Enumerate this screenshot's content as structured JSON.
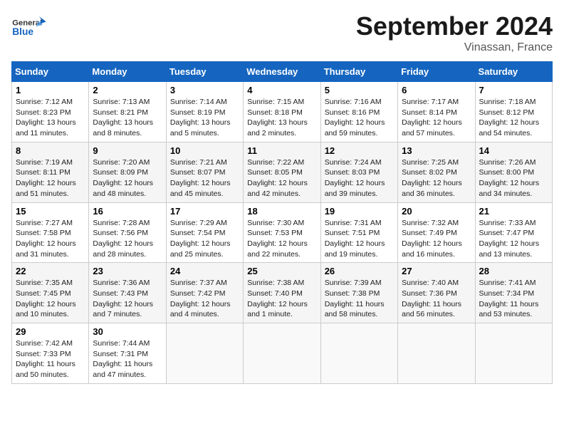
{
  "header": {
    "logo_line1": "General",
    "logo_line2": "Blue",
    "month": "September 2024",
    "location": "Vinassan, France"
  },
  "weekdays": [
    "Sunday",
    "Monday",
    "Tuesday",
    "Wednesday",
    "Thursday",
    "Friday",
    "Saturday"
  ],
  "weeks": [
    [
      {
        "day": "1",
        "info": "Sunrise: 7:12 AM\nSunset: 8:23 PM\nDaylight: 13 hours\nand 11 minutes."
      },
      {
        "day": "2",
        "info": "Sunrise: 7:13 AM\nSunset: 8:21 PM\nDaylight: 13 hours\nand 8 minutes."
      },
      {
        "day": "3",
        "info": "Sunrise: 7:14 AM\nSunset: 8:19 PM\nDaylight: 13 hours\nand 5 minutes."
      },
      {
        "day": "4",
        "info": "Sunrise: 7:15 AM\nSunset: 8:18 PM\nDaylight: 13 hours\nand 2 minutes."
      },
      {
        "day": "5",
        "info": "Sunrise: 7:16 AM\nSunset: 8:16 PM\nDaylight: 12 hours\nand 59 minutes."
      },
      {
        "day": "6",
        "info": "Sunrise: 7:17 AM\nSunset: 8:14 PM\nDaylight: 12 hours\nand 57 minutes."
      },
      {
        "day": "7",
        "info": "Sunrise: 7:18 AM\nSunset: 8:12 PM\nDaylight: 12 hours\nand 54 minutes."
      }
    ],
    [
      {
        "day": "8",
        "info": "Sunrise: 7:19 AM\nSunset: 8:11 PM\nDaylight: 12 hours\nand 51 minutes."
      },
      {
        "day": "9",
        "info": "Sunrise: 7:20 AM\nSunset: 8:09 PM\nDaylight: 12 hours\nand 48 minutes."
      },
      {
        "day": "10",
        "info": "Sunrise: 7:21 AM\nSunset: 8:07 PM\nDaylight: 12 hours\nand 45 minutes."
      },
      {
        "day": "11",
        "info": "Sunrise: 7:22 AM\nSunset: 8:05 PM\nDaylight: 12 hours\nand 42 minutes."
      },
      {
        "day": "12",
        "info": "Sunrise: 7:24 AM\nSunset: 8:03 PM\nDaylight: 12 hours\nand 39 minutes."
      },
      {
        "day": "13",
        "info": "Sunrise: 7:25 AM\nSunset: 8:02 PM\nDaylight: 12 hours\nand 36 minutes."
      },
      {
        "day": "14",
        "info": "Sunrise: 7:26 AM\nSunset: 8:00 PM\nDaylight: 12 hours\nand 34 minutes."
      }
    ],
    [
      {
        "day": "15",
        "info": "Sunrise: 7:27 AM\nSunset: 7:58 PM\nDaylight: 12 hours\nand 31 minutes."
      },
      {
        "day": "16",
        "info": "Sunrise: 7:28 AM\nSunset: 7:56 PM\nDaylight: 12 hours\nand 28 minutes."
      },
      {
        "day": "17",
        "info": "Sunrise: 7:29 AM\nSunset: 7:54 PM\nDaylight: 12 hours\nand 25 minutes."
      },
      {
        "day": "18",
        "info": "Sunrise: 7:30 AM\nSunset: 7:53 PM\nDaylight: 12 hours\nand 22 minutes."
      },
      {
        "day": "19",
        "info": "Sunrise: 7:31 AM\nSunset: 7:51 PM\nDaylight: 12 hours\nand 19 minutes."
      },
      {
        "day": "20",
        "info": "Sunrise: 7:32 AM\nSunset: 7:49 PM\nDaylight: 12 hours\nand 16 minutes."
      },
      {
        "day": "21",
        "info": "Sunrise: 7:33 AM\nSunset: 7:47 PM\nDaylight: 12 hours\nand 13 minutes."
      }
    ],
    [
      {
        "day": "22",
        "info": "Sunrise: 7:35 AM\nSunset: 7:45 PM\nDaylight: 12 hours\nand 10 minutes."
      },
      {
        "day": "23",
        "info": "Sunrise: 7:36 AM\nSunset: 7:43 PM\nDaylight: 12 hours\nand 7 minutes."
      },
      {
        "day": "24",
        "info": "Sunrise: 7:37 AM\nSunset: 7:42 PM\nDaylight: 12 hours\nand 4 minutes."
      },
      {
        "day": "25",
        "info": "Sunrise: 7:38 AM\nSunset: 7:40 PM\nDaylight: 12 hours\nand 1 minute."
      },
      {
        "day": "26",
        "info": "Sunrise: 7:39 AM\nSunset: 7:38 PM\nDaylight: 11 hours\nand 58 minutes."
      },
      {
        "day": "27",
        "info": "Sunrise: 7:40 AM\nSunset: 7:36 PM\nDaylight: 11 hours\nand 56 minutes."
      },
      {
        "day": "28",
        "info": "Sunrise: 7:41 AM\nSunset: 7:34 PM\nDaylight: 11 hours\nand 53 minutes."
      }
    ],
    [
      {
        "day": "29",
        "info": "Sunrise: 7:42 AM\nSunset: 7:33 PM\nDaylight: 11 hours\nand 50 minutes."
      },
      {
        "day": "30",
        "info": "Sunrise: 7:44 AM\nSunset: 7:31 PM\nDaylight: 11 hours\nand 47 minutes."
      },
      {
        "day": "",
        "info": ""
      },
      {
        "day": "",
        "info": ""
      },
      {
        "day": "",
        "info": ""
      },
      {
        "day": "",
        "info": ""
      },
      {
        "day": "",
        "info": ""
      }
    ]
  ]
}
